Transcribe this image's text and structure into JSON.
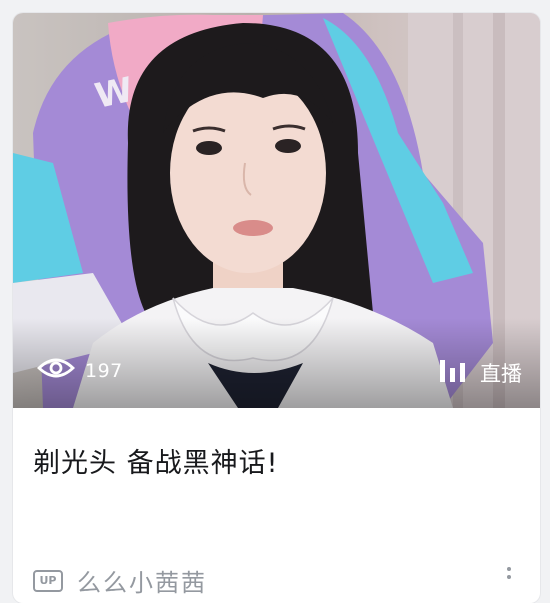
{
  "card": {
    "views": "197",
    "live_label": "直播",
    "title": "剃光头 备战黑神话!",
    "up_badge": "UP",
    "author": "么么小茜茜"
  },
  "icons": {
    "views": "eye-icon",
    "live": "live-bars-icon",
    "up": "up-badge-icon",
    "more": "more-vertical-icon"
  }
}
